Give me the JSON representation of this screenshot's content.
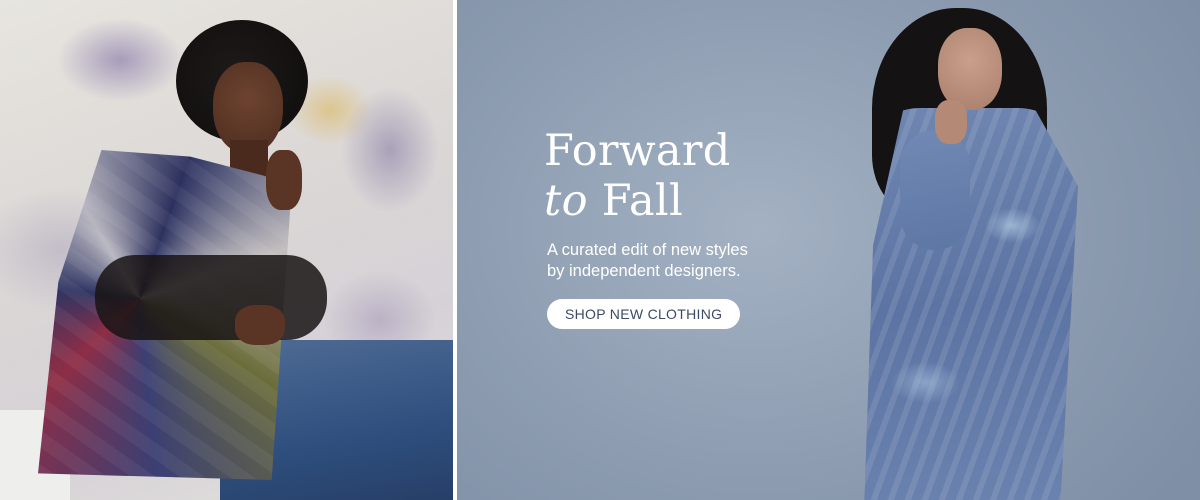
{
  "promo": {
    "headline": {
      "line1": "Forward",
      "line2_italic": "to",
      "line2_rest": "Fall"
    },
    "subheadline": {
      "line1": "A curated edit of new styles",
      "line2": "by independent designers."
    },
    "cta_label": "SHOP NEW CLOTHING"
  },
  "colors": {
    "panel_blue": "#8e9db1",
    "cta_text": "#3c4a66",
    "text_white": "#ffffff"
  }
}
